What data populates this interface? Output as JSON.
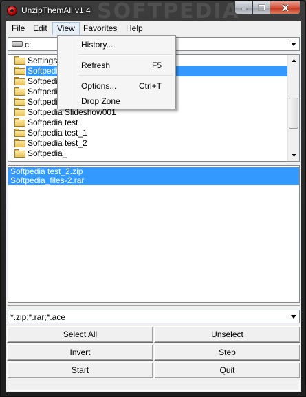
{
  "window": {
    "title": "UnzipThemAll v1.4",
    "watermark": "SOFTPEDIA"
  },
  "menubar": {
    "items": [
      "File",
      "Edit",
      "View",
      "Favorites",
      "Help"
    ],
    "active": "View"
  },
  "drive_combo": {
    "value": "c:"
  },
  "view_menu": {
    "items": [
      {
        "label": "History...",
        "shortcut": ""
      },
      {
        "label": "Refresh",
        "shortcut": "F5"
      },
      {
        "label": "Options...",
        "shortcut": "Ctrl+T"
      },
      {
        "label": "Drop Zone",
        "shortcut": ""
      }
    ]
  },
  "folder_tree": {
    "items": [
      {
        "label": "Settings",
        "selected": false
      },
      {
        "label": "Softpedia",
        "selected": true
      },
      {
        "label": "Softpedia",
        "selected": false
      },
      {
        "label": "Softpedia",
        "selected": false
      },
      {
        "label": "Softpedia",
        "selected": false
      },
      {
        "label": "Softpedia Slideshow001",
        "selected": false
      },
      {
        "label": "Softpedia test",
        "selected": false
      },
      {
        "label": "Softpedia test_1",
        "selected": false
      },
      {
        "label": "Softpedia test_2",
        "selected": false
      },
      {
        "label": "Softpedia_",
        "selected": false
      }
    ]
  },
  "file_list": {
    "items": [
      "Softpedia test_2.zip",
      "Softpedia_files-2.rar"
    ]
  },
  "filter_combo": {
    "value": "*.zip;*.rar;*.ace"
  },
  "buttons": {
    "select_all": "Select All",
    "unselect": "Unselect",
    "invert": "Invert",
    "step": "Step",
    "start": "Start",
    "quit": "Quit"
  },
  "colors": {
    "selection": "#3399ff",
    "close_button": "#c0341c"
  }
}
